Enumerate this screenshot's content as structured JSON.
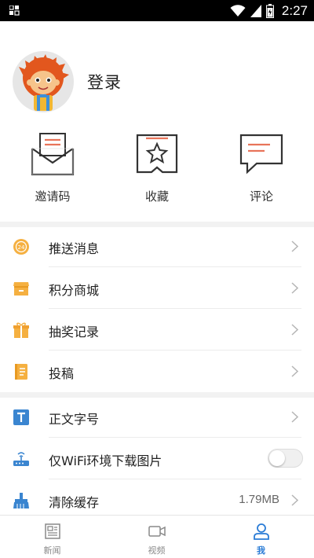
{
  "status_bar": {
    "time": "2:27"
  },
  "profile": {
    "login_label": "登录"
  },
  "quick_actions": [
    {
      "label": "邀请码",
      "icon": "invite-code-icon"
    },
    {
      "label": "收藏",
      "icon": "favorite-icon"
    },
    {
      "label": "评论",
      "icon": "comment-icon"
    }
  ],
  "menu_group1": [
    {
      "label": "推送消息",
      "icon": "push-message-icon"
    },
    {
      "label": "积分商城",
      "icon": "points-mall-icon"
    },
    {
      "label": "抽奖记录",
      "icon": "lottery-record-icon"
    },
    {
      "label": "投稿",
      "icon": "submission-icon"
    }
  ],
  "menu_group2": [
    {
      "label": "正文字号",
      "icon": "font-size-icon"
    },
    {
      "label": "仅WiFi环境下载图片",
      "icon": "wifi-router-icon",
      "toggle_on": false
    },
    {
      "label": "清除缓存",
      "icon": "clear-cache-icon",
      "value": "1.79MB"
    }
  ],
  "tabs": [
    {
      "label": "新闻",
      "icon": "news-icon",
      "active": false
    },
    {
      "label": "视频",
      "icon": "video-icon",
      "active": false
    },
    {
      "label": "我",
      "icon": "profile-icon",
      "active": true
    }
  ],
  "colors": {
    "accent": "#2a7cd6",
    "icon_orange": "#f5b041",
    "icon_blue": "#3a85d0",
    "quick_icon_accent": "#e8745a"
  }
}
